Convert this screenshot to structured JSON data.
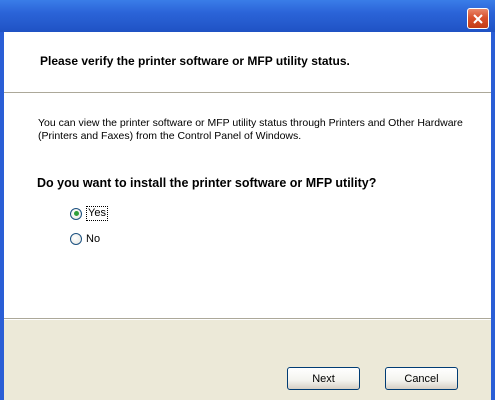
{
  "window": {
    "close_icon": "close-icon",
    "accent_color": "#2a5ed6",
    "close_color": "#d9512d"
  },
  "header": {
    "title": "Please verify the printer software or MFP utility status."
  },
  "content": {
    "info_text": "You can view the printer software or MFP utility status through Printers and Other Hardware (Printers and Faxes) from the Control Panel of Windows.",
    "question": "Do you want to install the printer software or MFP utility?",
    "options": [
      {
        "label": "Yes",
        "selected": true
      },
      {
        "label": "No",
        "selected": false
      }
    ]
  },
  "footer": {
    "next_label": "Next",
    "cancel_label": "Cancel"
  }
}
